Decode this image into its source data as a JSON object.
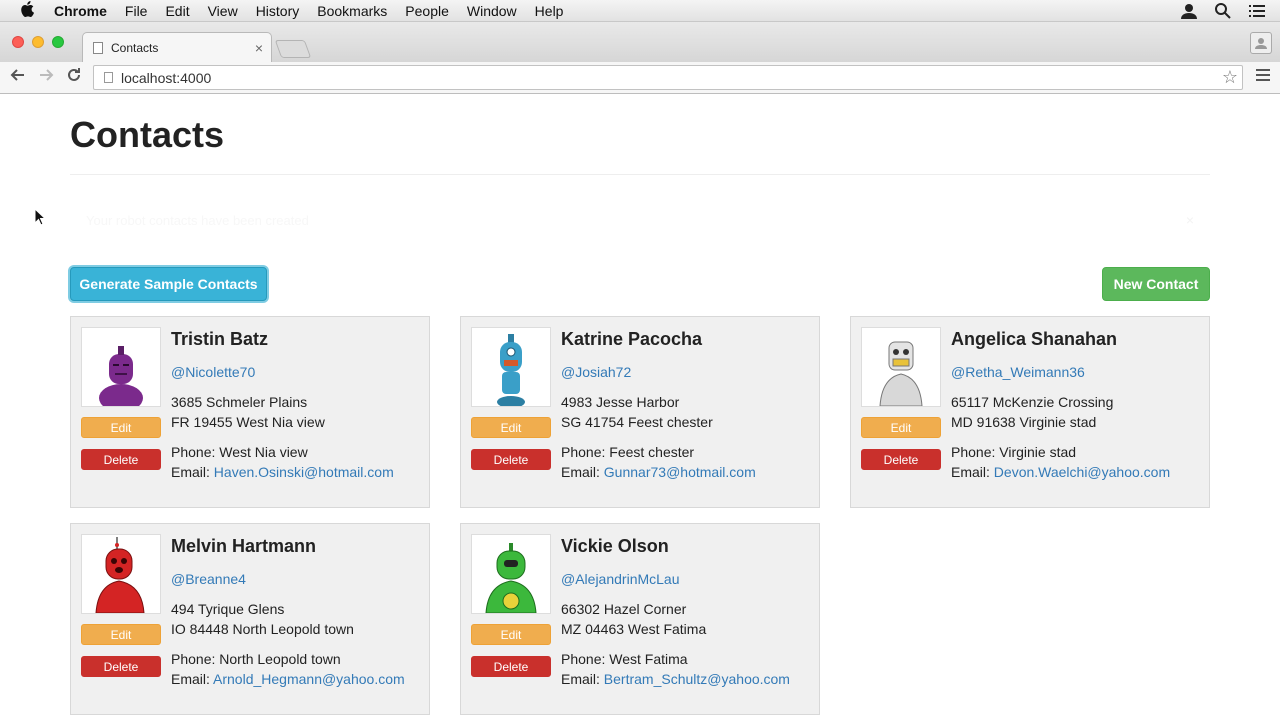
{
  "menubar": {
    "app": "Chrome",
    "items": [
      "File",
      "Edit",
      "View",
      "History",
      "Bookmarks",
      "People",
      "Window",
      "Help"
    ]
  },
  "browser": {
    "tab_title": "Contacts",
    "url": "localhost:4000"
  },
  "page": {
    "title": "Contacts",
    "alert": "Your robot contacts have been created",
    "alert_close": "×",
    "generate_label": "Generate Sample Contacts",
    "new_contact_label": "New Contact"
  },
  "labels": {
    "edit": "Edit",
    "delete": "Delete",
    "phone_prefix": "Phone: ",
    "email_prefix": "Email: "
  },
  "contacts": [
    {
      "name": "Tristin Batz",
      "handle": "@Nicolette70",
      "addr1": "3685 Schmeler Plains",
      "addr2": "FR 19455 West Nia view",
      "phone": "West Nia view",
      "email": "Haven.Osinski@hotmail.com",
      "robot_color": "#7b2a8c"
    },
    {
      "name": "Katrine Pacocha",
      "handle": "@Josiah72",
      "addr1": "4983 Jesse Harbor",
      "addr2": "SG 41754 Feest chester",
      "phone": "Feest chester",
      "email": "Gunnar73@hotmail.com",
      "robot_color": "#3a9fc8"
    },
    {
      "name": "Angelica Shanahan",
      "handle": "@Retha_Weimann36",
      "addr1": "65117 McKenzie Crossing",
      "addr2": "MD 91638 Virginie stad",
      "phone": "Virginie stad",
      "email": "Devon.Waelchi@yahoo.com",
      "robot_color": "#d8d8d8"
    },
    {
      "name": "Melvin Hartmann",
      "handle": "@Breanne4",
      "addr1": "494 Tyrique Glens",
      "addr2": "IO 84448 North Leopold town",
      "phone": "North Leopold town",
      "email": "Arnold_Hegmann@yahoo.com",
      "robot_color": "#d42424"
    },
    {
      "name": "Vickie Olson",
      "handle": "@AlejandrinMcLau",
      "addr1": "66302 Hazel Corner",
      "addr2": "MZ 04463 West Fatima",
      "phone": "West Fatima",
      "email": "Bertram_Schultz@yahoo.com",
      "robot_color": "#3cb83c"
    }
  ],
  "icons": {
    "apple": "apple-icon",
    "user": "user-icon",
    "search": "search-icon",
    "list": "list-icon",
    "back": "back-arrow-icon",
    "forward": "forward-arrow-icon",
    "reload": "reload-icon",
    "star": "star-icon",
    "menu": "hamburger-menu-icon",
    "page": "page-icon",
    "cursor": "mouse-cursor-icon"
  }
}
